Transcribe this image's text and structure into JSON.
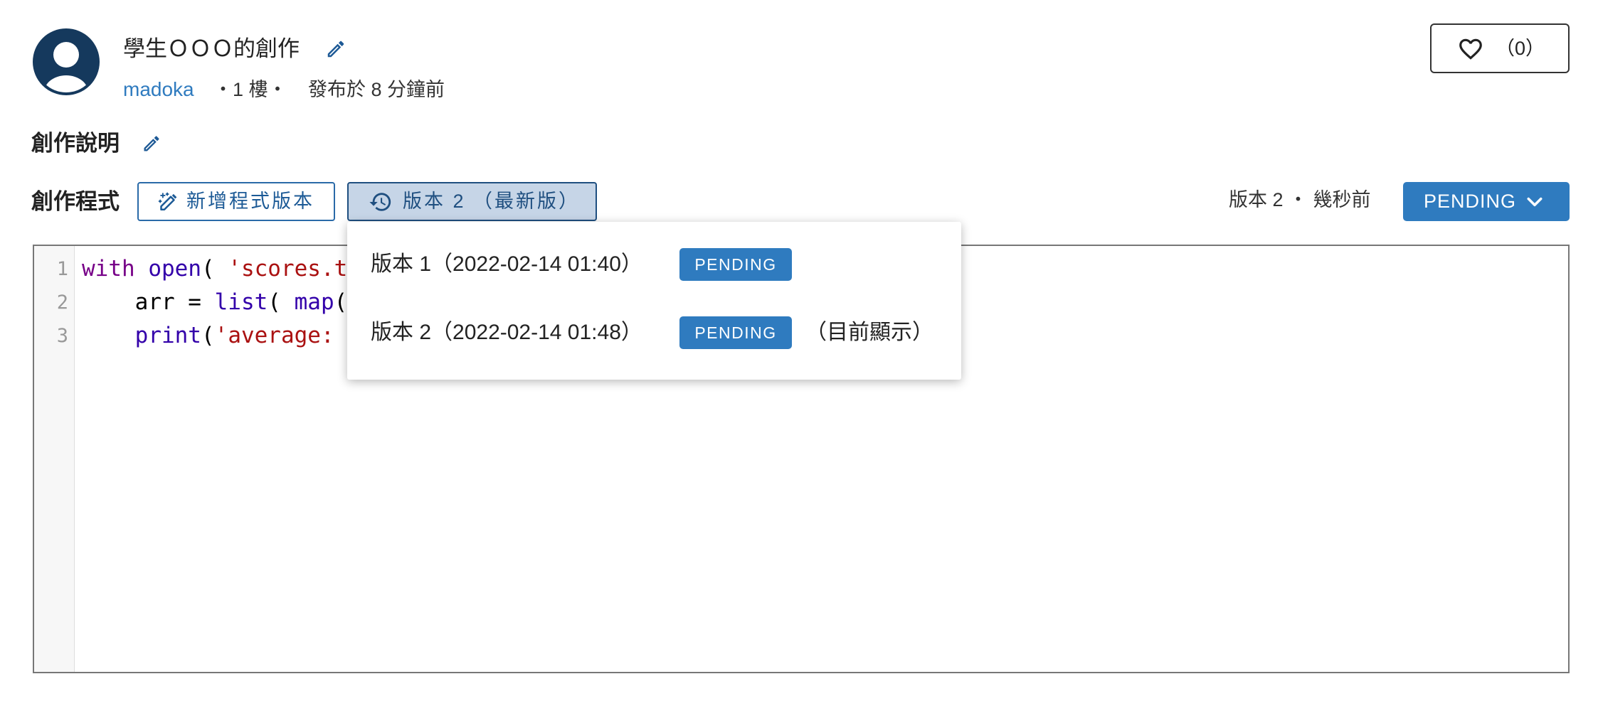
{
  "post": {
    "title": "學生ＯＯＯ的創作",
    "author": "madoka",
    "floor": "・1 樓・",
    "posted_time": "發布於 8 分鐘前",
    "like_count": "（0）"
  },
  "description": {
    "heading": "創作說明"
  },
  "program": {
    "heading": "創作程式",
    "new_version_button": "新增程式版本",
    "version_button": "版本 2 （最新版）",
    "current_version_info": "版本 2 ・ 幾秒前",
    "status_button": "PENDING"
  },
  "version_menu": {
    "items": [
      {
        "label": "版本 1（2022-02-14 01:40）",
        "status": "PENDING"
      },
      {
        "label": "版本 2（2022-02-14 01:48）",
        "status": "PENDING",
        "note": "（目前顯示）"
      }
    ]
  },
  "editor": {
    "line_numbers": [
      "1",
      "2",
      "3"
    ],
    "lines": [
      [
        "with",
        " ",
        "open",
        "( ",
        "'scores.t"
      ],
      [
        "    arr = ",
        "list",
        "( ",
        "map",
        "("
      ],
      [
        "    ",
        "print",
        "(",
        "'average:"
      ]
    ]
  },
  "icons": {
    "avatar": "user-avatar-icon",
    "edit": "pencil-icon",
    "new_version": "magic-pencil-icon",
    "version_history": "history-icon",
    "status_dropdown": "chevron-down-icon",
    "like": "heart-outline-icon"
  },
  "colors": {
    "accent": "#2f7bbf",
    "link": "#2f7bbf",
    "avatar_bg": "#15395d",
    "version_button_bg": "#c6d5e7",
    "code_keyword": "#770088",
    "code_builtin": "#3300aa",
    "code_string": "#aa1111"
  }
}
